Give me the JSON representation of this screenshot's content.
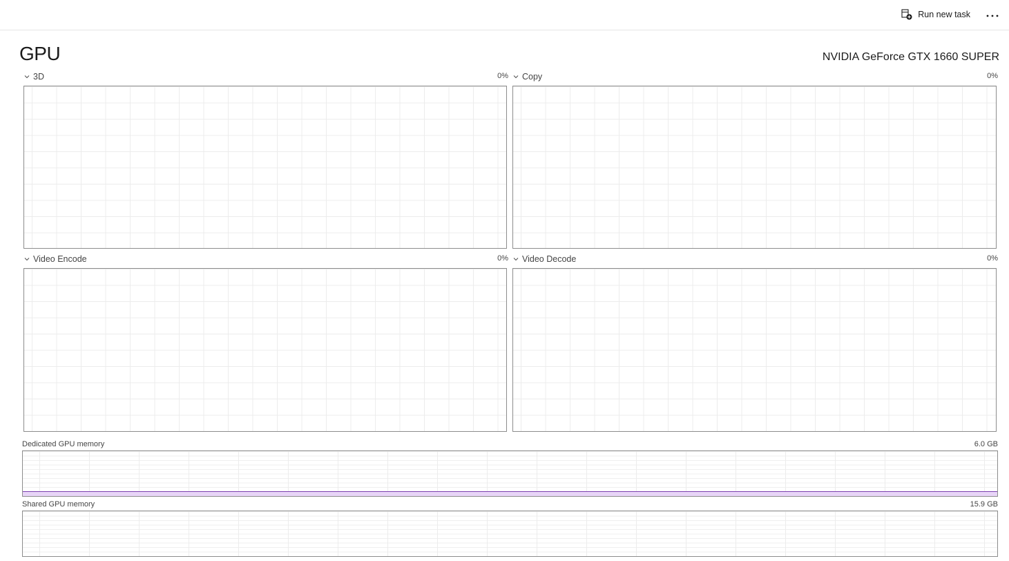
{
  "toolbar": {
    "run_new_task_label": "Run new task",
    "run_new_task_icon": "run-task-icon",
    "more_icon": "more-options-icon"
  },
  "header": {
    "title": "GPU",
    "device_name": "NVIDIA GeForce GTX 1660 SUPER"
  },
  "engines": [
    {
      "label": "3D",
      "value": "0%"
    },
    {
      "label": "Copy",
      "value": "0%"
    },
    {
      "label": "Video Encode",
      "value": "0%"
    },
    {
      "label": "Video Decode",
      "value": "0%"
    }
  ],
  "memory": {
    "dedicated": {
      "label": "Dedicated GPU memory",
      "total": "6.0 GB",
      "usage_fraction": 0.09
    },
    "shared": {
      "label": "Shared GPU memory",
      "total": "15.9 GB",
      "usage_fraction": 0
    }
  },
  "colors": {
    "dedicated_fill": "#e8d5f7",
    "dedicated_line": "#7b3fb0",
    "graph_border": "#8c8c8c",
    "grid": "#ececec"
  }
}
